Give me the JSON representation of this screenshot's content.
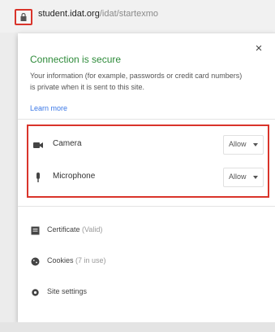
{
  "browser": {
    "url_host": "student.idat.org",
    "url_path": "/idat/startexmo",
    "lock_icon": "lock-icon"
  },
  "popup": {
    "title": "Connection is secure",
    "description": "Your information (for example, passwords or credit card numbers) is private when it is sent to this site.",
    "learn_more": "Learn more",
    "close_glyph": "×",
    "permissions": [
      {
        "label": "Camera",
        "value": "Allow",
        "icon": "camera-icon"
      },
      {
        "label": "Microphone",
        "value": "Allow",
        "icon": "microphone-icon"
      }
    ],
    "menu": [
      {
        "label": "Certificate",
        "sub": "(Valid)",
        "icon": "certificate-icon"
      },
      {
        "label": "Cookies",
        "sub": "(7 in use)",
        "icon": "cookie-icon"
      },
      {
        "label": "Site settings",
        "sub": "",
        "icon": "gear-icon"
      }
    ]
  },
  "colors": {
    "secure_green": "#2e8b3a",
    "highlight_red": "#d9342b",
    "link_blue": "#3b78e7"
  }
}
